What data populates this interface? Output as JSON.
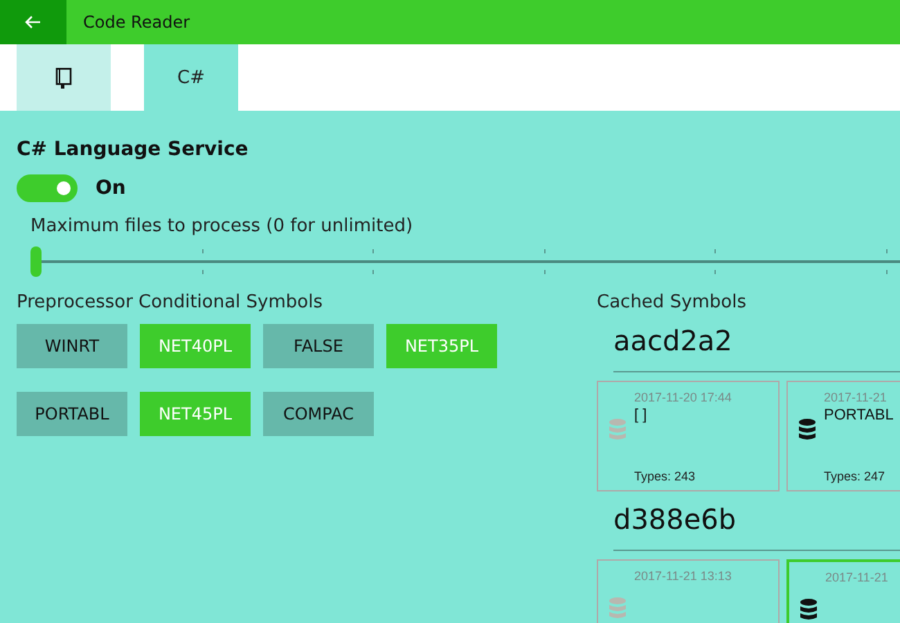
{
  "window": {
    "title": "Code Reader"
  },
  "tabs": [
    {
      "kind": "icon",
      "selected": false
    },
    {
      "kind": "text",
      "label": "C#",
      "selected": true
    }
  ],
  "service": {
    "title": "C# Language Service",
    "toggle": {
      "on": true,
      "label": "On"
    }
  },
  "max_files": {
    "label": "Maximum files to process (0 for unlimited)",
    "level": 0
  },
  "symbols": {
    "title": "Preprocessor Conditional Symbols",
    "items": [
      {
        "label": "WINRT",
        "selected": false
      },
      {
        "label": "NET40PL",
        "selected": true
      },
      {
        "label": "FALSE",
        "selected": false
      },
      {
        "label": "NET35PL",
        "selected": true
      },
      {
        "label": "PORTABL",
        "selected": false
      },
      {
        "label": "NET45PL",
        "selected": true
      },
      {
        "label": "COMPAC",
        "selected": false
      }
    ]
  },
  "cached": {
    "title": "Cached Symbols",
    "groups": [
      {
        "name": "aacd2a2",
        "cards": [
          {
            "date": "2017-11-20 17:44",
            "symbols": "[ ]",
            "types": "Types: 243",
            "loaded": false,
            "selected": false
          },
          {
            "date": "2017-11-21",
            "symbols": "PORTABL",
            "types": "Types: 247",
            "loaded": true,
            "selected": false
          }
        ]
      },
      {
        "name": "d388e6b",
        "cards": [
          {
            "date": "2017-11-21 13:13",
            "loaded": false,
            "selected": false
          },
          {
            "date": "2017-11-21",
            "loaded": true,
            "selected": true
          }
        ]
      }
    ]
  }
}
